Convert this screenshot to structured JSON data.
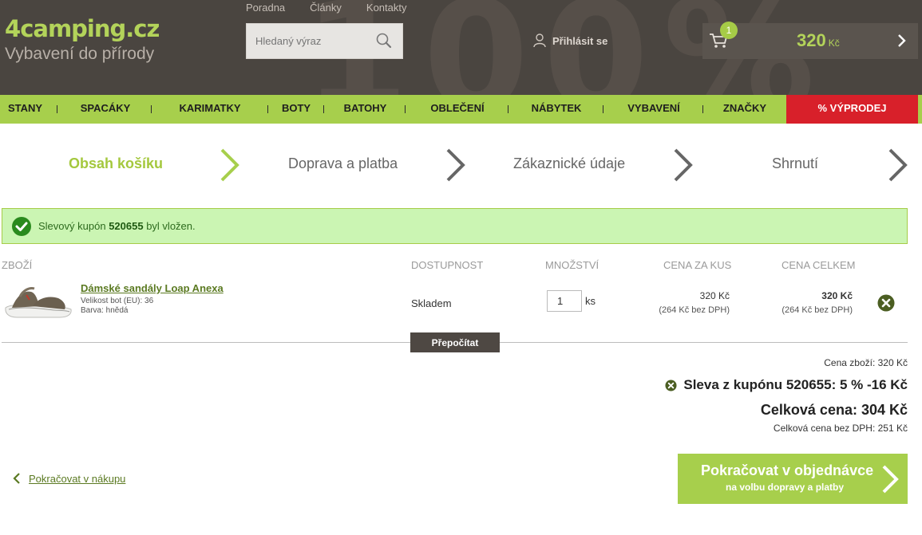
{
  "header": {
    "logo_num": "4",
    "logo_text": "camping.cz",
    "tagline": "Vybavení do přírody",
    "top_links": [
      "Poradna",
      "Články",
      "Kontakty"
    ],
    "search_placeholder": "Hledaný výraz",
    "login_label": "Přihlásit se",
    "cart_count": "1",
    "cart_price": "320",
    "cart_currency": "Kč"
  },
  "nav": {
    "items": [
      "STANY",
      "SPACÁKY",
      "KARIMATKY",
      "BOTY",
      "BATOHY",
      "OBLEČENÍ",
      "NÁBYTEK",
      "VYBAVENÍ",
      "ZNAČKY"
    ],
    "sale": "% VÝPRODEJ"
  },
  "steps": [
    "Obsah košíku",
    "Doprava a platba",
    "Zákaznické údaje",
    "Shrnutí"
  ],
  "notice": {
    "prefix": "Slevový kupón",
    "code": "520655",
    "suffix": "byl vložen."
  },
  "table": {
    "headers": [
      "ZBOŽÍ",
      "DOSTUPNOST",
      "MNOŽSTVÍ",
      "CENA ZA KUS",
      "CENA CELKEM"
    ],
    "item": {
      "name": "Dámské sandály Loap Anexa",
      "size": "Velikost bot (EU): 36",
      "color": "Barva: hnědá",
      "availability": "Skladem",
      "quantity": "1",
      "unit": "ks",
      "unit_price": "320 Kč",
      "unit_price_net": "(264 Kč bez DPH)",
      "total_price": "320 Kč",
      "total_price_net": "(264 Kč bez DPH)"
    },
    "recalc_label": "Přepočítat"
  },
  "totals": {
    "goods": "Cena zboží: 320 Kč",
    "discount": "Sleva z kupónu 520655: 5 % -16 Kč",
    "total": "Celková cena: 304 Kč",
    "total_net": "Celková cena bez DPH: 251 Kč"
  },
  "actions": {
    "back": "Pokračovat v nákupu",
    "continue_title": "Pokračovat v objednávce",
    "continue_sub": "na volbu dopravy a platby"
  },
  "colors": {
    "brand_green": "#a7cf4c",
    "header_bg": "#4a4540",
    "sale_red": "#d8202a"
  }
}
